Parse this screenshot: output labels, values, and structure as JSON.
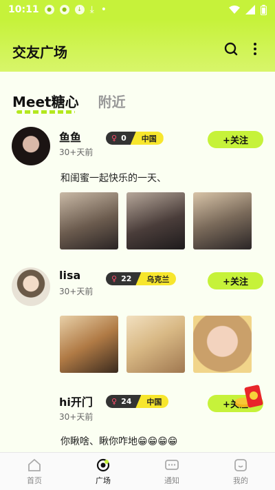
{
  "status_bar": {
    "time": "10:11",
    "icons": [
      "app-notification-icon",
      "app-notification-icon",
      "download-icon",
      "download-icon",
      "dot-icon"
    ],
    "right_icons": [
      "wifi-icon",
      "signal-icon",
      "battery-icon"
    ]
  },
  "header": {
    "title": "交友广场"
  },
  "tabs": [
    {
      "label": "Meet糖心",
      "active": true
    },
    {
      "label": "附近",
      "active": false
    }
  ],
  "posts": [
    {
      "name": "鱼鱼",
      "time": "30+天前",
      "badge_count": "0",
      "badge_region": "中国",
      "follow_label": "+关注",
      "text": "和闺蜜一起快乐的一天、"
    },
    {
      "name": "lisa",
      "time": "30+天前",
      "badge_count": "22",
      "badge_region": "乌克兰",
      "follow_label": "+关注",
      "text": ""
    },
    {
      "name": "hi开门",
      "time": "30+天前",
      "badge_count": "24",
      "badge_region": "中国",
      "follow_label": "+关注",
      "text": "你瞅啥、瞅你咋地😁😁😁😁"
    }
  ],
  "bottom_nav": [
    {
      "label": "首页",
      "active": false
    },
    {
      "label": "广场",
      "active": true
    },
    {
      "label": "通知",
      "active": false
    },
    {
      "label": "我的",
      "active": false
    }
  ],
  "colors": {
    "accent": "#c6f23a",
    "badge_dark": "#333333",
    "badge_yellow": "#f7e62d"
  }
}
